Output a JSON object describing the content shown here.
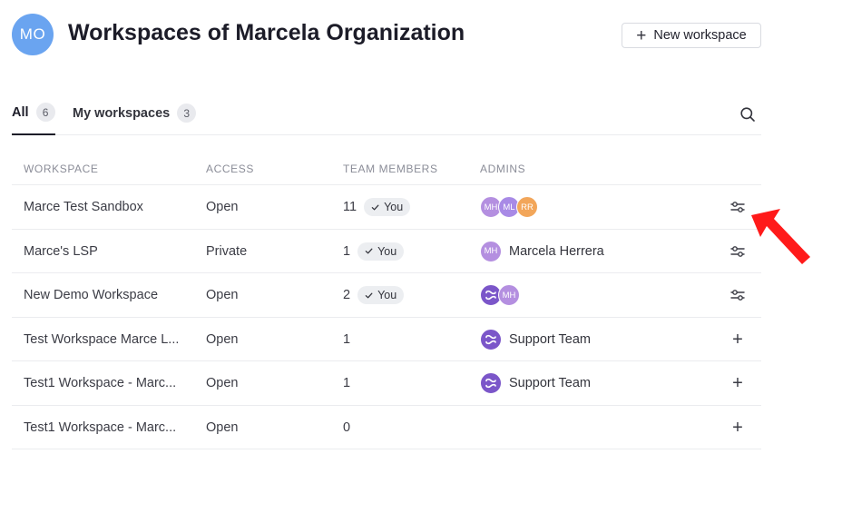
{
  "header": {
    "avatar_initials": "MO",
    "avatar_color": "#6aa4f0",
    "title": "Workspaces of Marcela Organization",
    "new_workspace_label": "New workspace"
  },
  "tabs": [
    {
      "label": "All",
      "count": "6",
      "active": true
    },
    {
      "label": "My workspaces",
      "count": "3",
      "active": false
    }
  ],
  "table": {
    "headers": [
      "WORKSPACE",
      "ACCESS",
      "TEAM MEMBERS",
      "ADMINS"
    ],
    "rows": [
      {
        "name": "Marce Test Sandbox",
        "access": "Open",
        "members": "11",
        "you": "You",
        "action": "settings"
      },
      {
        "name": "Marce's LSP",
        "access": "Private",
        "members": "1",
        "you": "You",
        "admin_name": "Marcela Herrera",
        "action": "settings"
      },
      {
        "name": "New Demo Workspace",
        "access": "Open",
        "members": "2",
        "you": "You",
        "action": "settings"
      },
      {
        "name": "Test Workspace Marce L...",
        "access": "Open",
        "members": "1",
        "admin_name": "Support Team",
        "action": "add"
      },
      {
        "name": "Test1 Workspace - Marc...",
        "access": "Open",
        "members": "1",
        "admin_name": "Support Team",
        "action": "add"
      },
      {
        "name": "Test1 Workspace - Marc...",
        "access": "Open",
        "members": "0",
        "action": "add"
      }
    ]
  },
  "admins": {
    "mh": {
      "initials": "MH",
      "color": "#b48fe0"
    },
    "ml": {
      "initials": "ML",
      "color": "#a88ae6"
    },
    "rr": {
      "initials": "RR",
      "color": "#f2a65a"
    },
    "brand_color": "#7b56c9"
  },
  "colors": {
    "pointer": "#ff1a1a"
  }
}
